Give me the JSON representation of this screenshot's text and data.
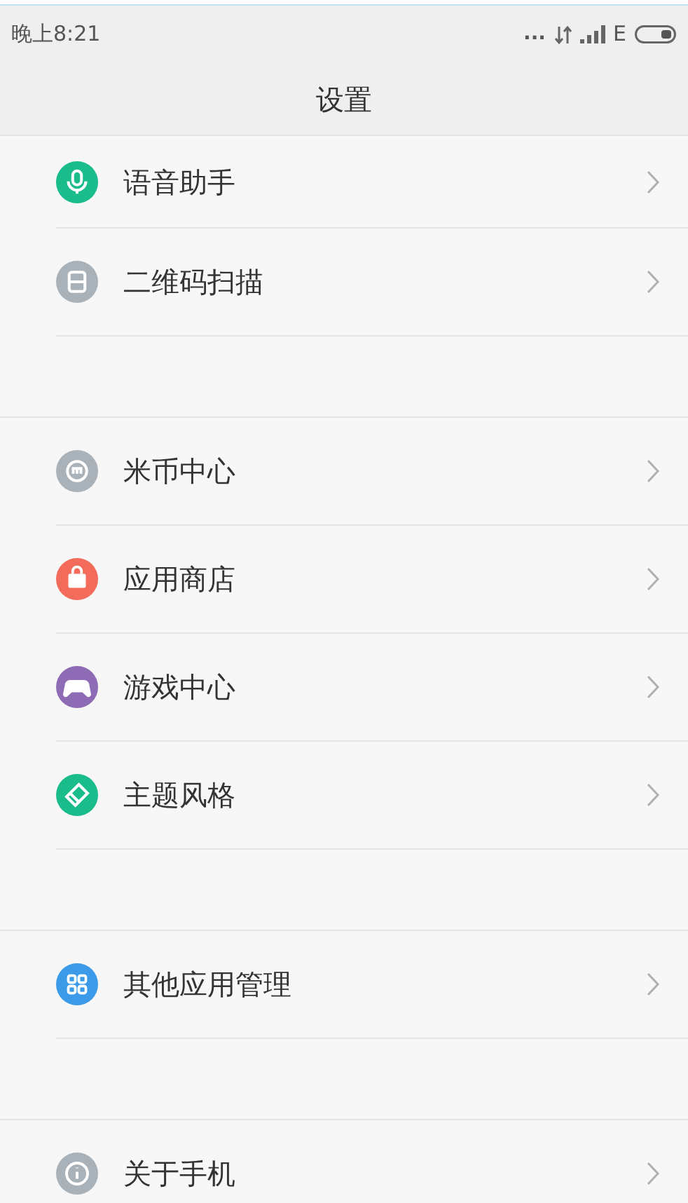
{
  "status_bar": {
    "time": "晚上8:21",
    "more": "...",
    "network": "E"
  },
  "title": "设置",
  "groups": [
    {
      "items": [
        {
          "label": "语音助手",
          "kind": "mic",
          "color": "#1abc8c"
        },
        {
          "label": "二维码扫描",
          "kind": "scan",
          "color": "#a9b1b9"
        }
      ]
    },
    {
      "items": [
        {
          "label": "米币中心",
          "kind": "coin",
          "color": "#a9b1b9"
        },
        {
          "label": "应用商店",
          "kind": "bag",
          "color": "#f26b5b"
        },
        {
          "label": "游戏中心",
          "kind": "gamepad",
          "color": "#8e6bb5"
        },
        {
          "label": "主题风格",
          "kind": "brush",
          "color": "#1abc8c"
        }
      ]
    },
    {
      "items": [
        {
          "label": "其他应用管理",
          "kind": "grid",
          "color": "#3b9be8"
        }
      ]
    },
    {
      "items": [
        {
          "label": "关于手机",
          "kind": "info",
          "color": "#a9b1b9"
        }
      ]
    }
  ]
}
